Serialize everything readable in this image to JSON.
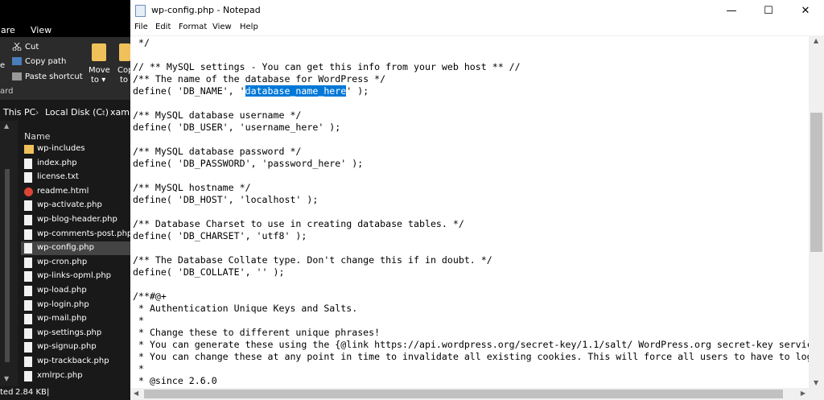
{
  "explorer": {
    "tabs": {
      "share_partial": "are",
      "view": "View"
    },
    "clipboard": {
      "cut": "Cut",
      "copy_path": "Copy path",
      "paste_shortcut": "Paste shortcut",
      "group_partial": "ard",
      "left_partial": "e"
    },
    "organize": {
      "move_to": "Move",
      "move_to_sub": "to ▾",
      "copy_partial": "Cop",
      "copy_partial_sub": "to"
    },
    "address": {
      "crumbs": [
        "This PC",
        "Local Disk (C:)",
        "xamp"
      ],
      "sep": "›"
    },
    "columns": {
      "name": "Name"
    },
    "files": [
      {
        "name": "wp-includes",
        "kind": "folder"
      },
      {
        "name": "index.php",
        "kind": "file"
      },
      {
        "name": "license.txt",
        "kind": "file"
      },
      {
        "name": "readme.html",
        "kind": "chrome"
      },
      {
        "name": "wp-activate.php",
        "kind": "file"
      },
      {
        "name": "wp-blog-header.php",
        "kind": "file"
      },
      {
        "name": "wp-comments-post.php",
        "kind": "file"
      },
      {
        "name": "wp-config.php",
        "kind": "file",
        "selected": true
      },
      {
        "name": "wp-cron.php",
        "kind": "file"
      },
      {
        "name": "wp-links-opml.php",
        "kind": "file"
      },
      {
        "name": "wp-load.php",
        "kind": "file"
      },
      {
        "name": "wp-login.php",
        "kind": "file"
      },
      {
        "name": "wp-mail.php",
        "kind": "file"
      },
      {
        "name": "wp-settings.php",
        "kind": "file"
      },
      {
        "name": "wp-signup.php",
        "kind": "file"
      },
      {
        "name": "wp-trackback.php",
        "kind": "file"
      },
      {
        "name": "xmlrpc.php",
        "kind": "file"
      }
    ],
    "status": {
      "selected_partial": "ted",
      "size": "2.84 KB",
      "cursor": "|"
    }
  },
  "notepad": {
    "title": "wp-config.php - Notepad",
    "window_buttons": {
      "minimize": "—",
      "maximize": "☐",
      "close": "✕"
    },
    "menu": [
      "File",
      "Edit",
      "Format",
      "View",
      "Help"
    ],
    "highlight": "database_name_here",
    "lines": [
      " */",
      "",
      "// ** MySQL settings - You can get this info from your web host ** //",
      "/** The name of the database for WordPress */",
      "define( 'DB_NAME', 'database_name_here' );",
      "",
      "/** MySQL database username */",
      "define( 'DB_USER', 'username_here' );",
      "",
      "/** MySQL database password */",
      "define( 'DB_PASSWORD', 'password_here' );",
      "",
      "/** MySQL hostname */",
      "define( 'DB_HOST', 'localhost' );",
      "",
      "/** Database Charset to use in creating database tables. */",
      "define( 'DB_CHARSET', 'utf8' );",
      "",
      "/** The Database Collate type. Don't change this if in doubt. */",
      "define( 'DB_COLLATE', '' );",
      "",
      "/**#@+",
      " * Authentication Unique Keys and Salts.",
      " *",
      " * Change these to different unique phrases!",
      " * You can generate these using the {@link https://api.wordpress.org/secret-key/1.1/salt/ WordPress.org secret-key service}",
      " * You can change these at any point in time to invalidate all existing cookies. This will force all users to have to log in ag",
      " *",
      " * @since 2.6.0"
    ],
    "scroll_arrows": {
      "up": "▲",
      "down": "▼",
      "left": "◀",
      "right": "▶"
    }
  }
}
